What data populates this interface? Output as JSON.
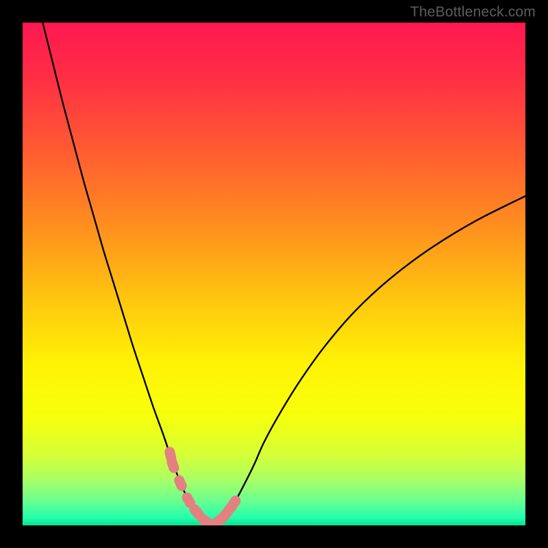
{
  "watermark": "TheBottleneck.com",
  "chart_data": {
    "type": "line",
    "title": "",
    "xlabel": "",
    "ylabel": "",
    "xlim": [
      0,
      100
    ],
    "ylim": [
      0,
      100
    ],
    "background_gradient_stops": [
      {
        "offset": 0.0,
        "color": "#ff1850"
      },
      {
        "offset": 0.1,
        "color": "#ff2c46"
      },
      {
        "offset": 0.25,
        "color": "#ff5a32"
      },
      {
        "offset": 0.4,
        "color": "#ff8d1f"
      },
      {
        "offset": 0.55,
        "color": "#ffc60f"
      },
      {
        "offset": 0.68,
        "color": "#fff305"
      },
      {
        "offset": 0.78,
        "color": "#f8ff0a"
      },
      {
        "offset": 0.86,
        "color": "#d6ff37"
      },
      {
        "offset": 0.91,
        "color": "#a8ff66"
      },
      {
        "offset": 0.95,
        "color": "#6cff8f"
      },
      {
        "offset": 0.985,
        "color": "#23ffad"
      },
      {
        "offset": 1.0,
        "color": "#05e38f"
      }
    ],
    "series": [
      {
        "name": "bottleneck-curve",
        "x": [
          4,
          6,
          8,
          10,
          12,
          14,
          16,
          18,
          20,
          22,
          24,
          26,
          28,
          29.5,
          31,
          32.5,
          34,
          35.5,
          36.5,
          37.5,
          38.5,
          40,
          42,
          44,
          46,
          48,
          51,
          55,
          60,
          66,
          73,
          81,
          90,
          100
        ],
        "y": [
          100,
          92,
          84,
          76.5,
          69,
          62,
          55,
          48.5,
          42,
          35.5,
          29.5,
          23.5,
          18,
          13.5,
          9.5,
          6,
          3.3,
          1.5,
          0.6,
          0.3,
          0.6,
          1.7,
          4.3,
          8,
          12,
          16.5,
          22,
          28.5,
          35.5,
          42.5,
          49,
          55,
          60.5,
          65.5
        ]
      }
    ],
    "markers": {
      "name": "curve-markers",
      "color": "#e58080",
      "x": [
        29.4,
        29.9,
        31.4,
        33.0,
        34.6,
        36.2,
        37.8,
        39.4,
        40.2,
        41.3,
        42.0
      ],
      "y": [
        14.0,
        12.0,
        8.4,
        5.0,
        2.7,
        1.0,
        0.3,
        1.2,
        2.0,
        3.4,
        4.4
      ]
    }
  }
}
